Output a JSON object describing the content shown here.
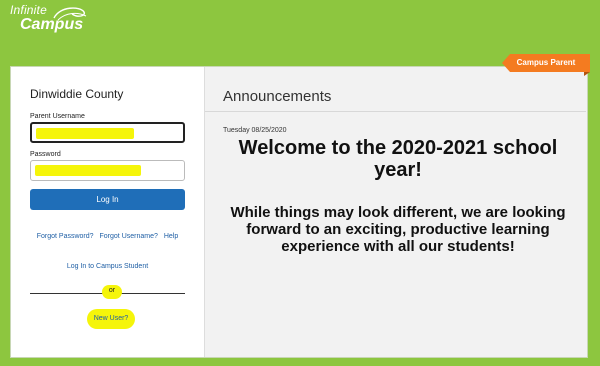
{
  "logo": {
    "line1": "Infinite",
    "line2": "Campus"
  },
  "badge": {
    "label": "Campus Parent"
  },
  "login": {
    "district": "Dinwiddie County",
    "username_label": "Parent Username",
    "password_label": "Password",
    "login_button": "Log In",
    "forgot_password": "Forgot Password?",
    "forgot_username": "Forgot Username?",
    "help": "Help",
    "campus_student": "Log In to Campus Student",
    "or": "or",
    "new_user": "New User?"
  },
  "announcements": {
    "title": "Announcements",
    "date": "Tuesday 08/25/2020",
    "headline": "Welcome to the 2020-2021 school year!",
    "body": "While things may look different, we are looking forward to an exciting, productive learning experience with all our students!"
  },
  "colors": {
    "accent_green": "#8dc63f",
    "button_blue": "#1f6eb8",
    "badge_orange": "#f47b20",
    "highlight": "#f5f50a"
  }
}
